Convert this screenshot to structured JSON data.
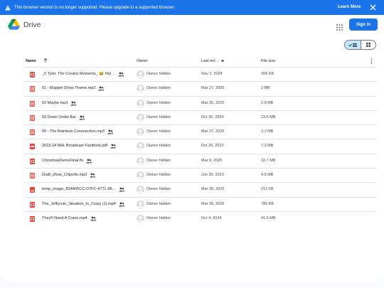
{
  "banner": {
    "icon": "warning-icon",
    "message": "This browser version is no longer supported. Please upgrade to a supported browser.",
    "learn_more": "Learn More",
    "close_icon": "close-icon"
  },
  "header": {
    "brand": "Drive",
    "signin_label": "Sign in",
    "apps_icon": "apps-grid-icon"
  },
  "colors": {
    "accent": "#1a73e8",
    "video_icon": "#ea4335",
    "selected_toggle": "#c2e7ff"
  },
  "table": {
    "columns": {
      "name": "Name",
      "owner": "Owner",
      "modified": "Last mo…",
      "size": "File size"
    },
    "files": [
      {
        "name": "_5 Tyler, The Creator Moments_ 😂 #tyl…",
        "icon": "video-file-icon",
        "owner": "Owner hidden",
        "modified": "Nov 2, 2024",
        "size": "309 KB"
      },
      {
        "name": "01 - Muppet Show Theme.mp3",
        "icon": "audio-file-icon",
        "owner": "Owner hidden",
        "modified": "Mar 27, 2025",
        "size": "2 MB"
      },
      {
        "name": "02 Maybe.mp3",
        "icon": "audio-file-icon",
        "owner": "Owner hidden",
        "modified": "Mar 26, 2025",
        "size": "2.8 MB"
      },
      {
        "name": "03 Down Under.flac",
        "icon": "audio-file-icon",
        "owner": "Owner hidden",
        "modified": "Oct 30, 2024",
        "size": "23.6 MB"
      },
      {
        "name": "09 - The Rainbow Cononection.mp3",
        "icon": "audio-file-icon",
        "owner": "Owner hidden",
        "modified": "Mar 27, 2025",
        "size": "3.2 MB"
      },
      {
        "name": "2023-24 NHL Broadcast Factbook.pdf",
        "icon": "pdf-file-icon",
        "owner": "Owner hidden",
        "modified": "Oct 26, 2023",
        "size": "7.2 MB"
      },
      {
        "name": "ChristmasDemoFinal.flv",
        "icon": "video-file-icon",
        "owner": "Owner hidden",
        "modified": "Mar 9, 2025",
        "size": "22.7 MB"
      },
      {
        "name": "Draft_show_Chipotle.mp3",
        "icon": "audio-file-icon",
        "owner": "Owner hidden",
        "modified": "Jun 30, 2023",
        "size": "4.5 MB"
      },
      {
        "name": "temp_image_834A05CC-D7FC-4771-98…",
        "icon": "image-file-icon",
        "owner": "Owner hidden",
        "modified": "Mar 30, 2025",
        "size": "211 KB"
      },
      {
        "name": "The_Jeffycoin_Situation_Is_Crazy (1).mp4",
        "icon": "video-file-icon",
        "owner": "Owner hidden",
        "modified": "Mar 26, 2025",
        "size": "780 KB"
      },
      {
        "name": "They'll Need A Crane.mp4",
        "icon": "video-file-icon",
        "owner": "Owner hidden",
        "modified": "Oct 4, 2024",
        "size": "41.5 MB"
      }
    ]
  }
}
